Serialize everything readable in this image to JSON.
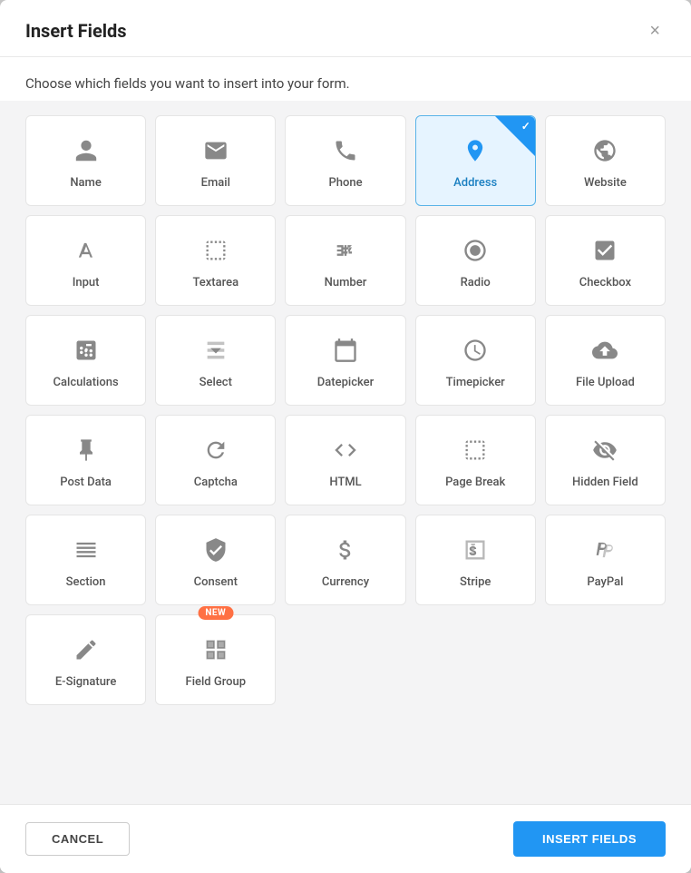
{
  "modal": {
    "title": "Insert Fields",
    "subtitle": "Choose which fields you want to insert into your form.",
    "close_label": "×"
  },
  "footer": {
    "cancel_label": "CANCEL",
    "insert_label": "INSERT FIELDS"
  },
  "fields": [
    {
      "id": "name",
      "label": "Name",
      "icon": "person",
      "selected": false,
      "new": false
    },
    {
      "id": "email",
      "label": "Email",
      "icon": "email",
      "selected": false,
      "new": false
    },
    {
      "id": "phone",
      "label": "Phone",
      "icon": "phone",
      "selected": false,
      "new": false
    },
    {
      "id": "address",
      "label": "Address",
      "icon": "location",
      "selected": true,
      "new": false
    },
    {
      "id": "website",
      "label": "Website",
      "icon": "globe",
      "selected": false,
      "new": false
    },
    {
      "id": "input",
      "label": "Input",
      "icon": "text",
      "selected": false,
      "new": false
    },
    {
      "id": "textarea",
      "label": "Textarea",
      "icon": "textarea",
      "selected": false,
      "new": false
    },
    {
      "id": "number",
      "label": "Number",
      "icon": "number",
      "selected": false,
      "new": false
    },
    {
      "id": "radio",
      "label": "Radio",
      "icon": "radio",
      "selected": false,
      "new": false
    },
    {
      "id": "checkbox",
      "label": "Checkbox",
      "icon": "checkbox",
      "selected": false,
      "new": false
    },
    {
      "id": "calculations",
      "label": "Calculations",
      "icon": "calculator",
      "selected": false,
      "new": false
    },
    {
      "id": "select",
      "label": "Select",
      "icon": "select",
      "selected": false,
      "new": false
    },
    {
      "id": "datepicker",
      "label": "Datepicker",
      "icon": "calendar",
      "selected": false,
      "new": false
    },
    {
      "id": "timepicker",
      "label": "Timepicker",
      "icon": "clock",
      "selected": false,
      "new": false
    },
    {
      "id": "fileupload",
      "label": "File Upload",
      "icon": "upload",
      "selected": false,
      "new": false
    },
    {
      "id": "postdata",
      "label": "Post Data",
      "icon": "pin",
      "selected": false,
      "new": false
    },
    {
      "id": "captcha",
      "label": "Captcha",
      "icon": "refresh",
      "selected": false,
      "new": false
    },
    {
      "id": "html",
      "label": "HTML",
      "icon": "code",
      "selected": false,
      "new": false
    },
    {
      "id": "pagebreak",
      "label": "Page Break",
      "icon": "pagebreak",
      "selected": false,
      "new": false
    },
    {
      "id": "hiddenfield",
      "label": "Hidden Field",
      "icon": "hidden",
      "selected": false,
      "new": false
    },
    {
      "id": "section",
      "label": "Section",
      "icon": "section",
      "selected": false,
      "new": false
    },
    {
      "id": "consent",
      "label": "Consent",
      "icon": "shield",
      "selected": false,
      "new": false
    },
    {
      "id": "currency",
      "label": "Currency",
      "icon": "dollar",
      "selected": false,
      "new": false
    },
    {
      "id": "stripe",
      "label": "Stripe",
      "icon": "stripe",
      "selected": false,
      "new": false
    },
    {
      "id": "paypal",
      "label": "PayPal",
      "icon": "paypal",
      "selected": false,
      "new": false
    },
    {
      "id": "esignature",
      "label": "E-Signature",
      "icon": "pen",
      "selected": false,
      "new": false
    },
    {
      "id": "fieldgroup",
      "label": "Field Group",
      "icon": "fieldgroup",
      "selected": false,
      "new": true
    }
  ]
}
